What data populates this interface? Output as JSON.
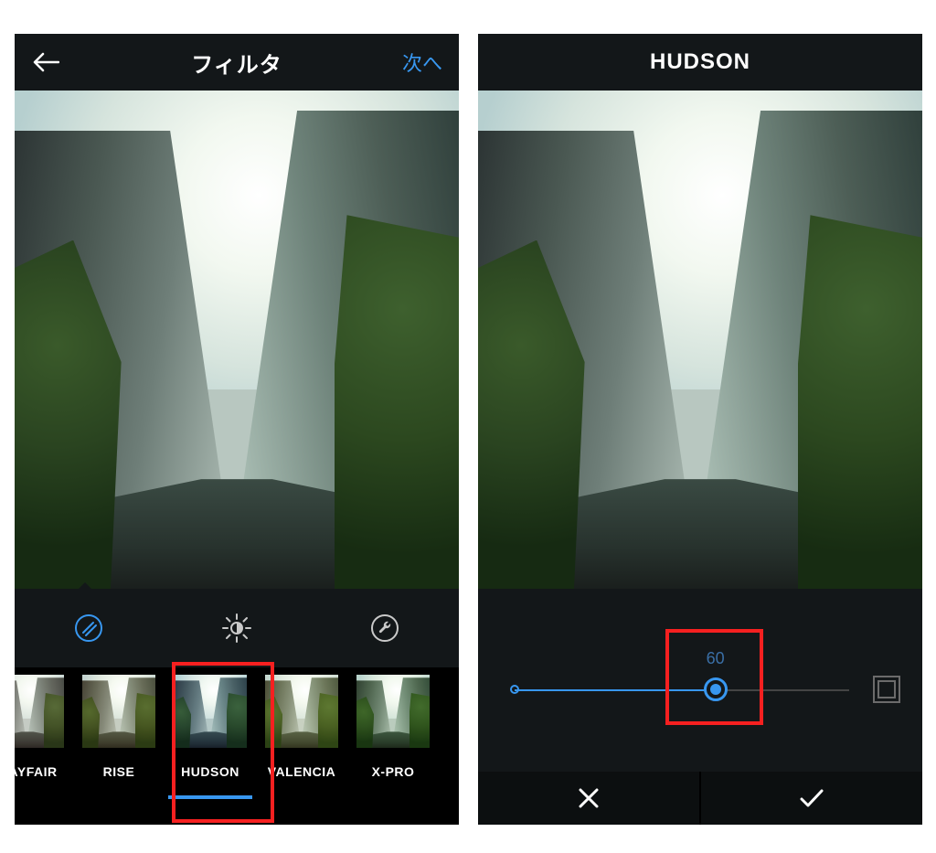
{
  "left": {
    "header": {
      "title": "フィルタ",
      "next_label": "次へ"
    },
    "tabs": {
      "filters_icon": "effects-icon",
      "lux_icon": "sun-icon",
      "tools_icon": "wrench-icon",
      "active": "filters"
    },
    "filters": [
      {
        "name": "MAYFAIR",
        "tint": "t-mayfair",
        "display": "MAYFAIR"
      },
      {
        "name": "RISE",
        "tint": "t-rise",
        "display": "RISE"
      },
      {
        "name": "HUDSON",
        "tint": "t-hudson",
        "display": "HUDSON",
        "selected": true
      },
      {
        "name": "VALENCIA",
        "tint": "t-valencia",
        "display": "VALENCIA"
      },
      {
        "name": "X-PRO",
        "tint": "t-xpro",
        "display": "X-PRO"
      }
    ]
  },
  "right": {
    "header": {
      "title": "HUDSON"
    },
    "slider": {
      "value": 60,
      "min": 0,
      "max": 100
    }
  },
  "colors": {
    "accent": "#3897f0",
    "highlight": "#f62020"
  }
}
